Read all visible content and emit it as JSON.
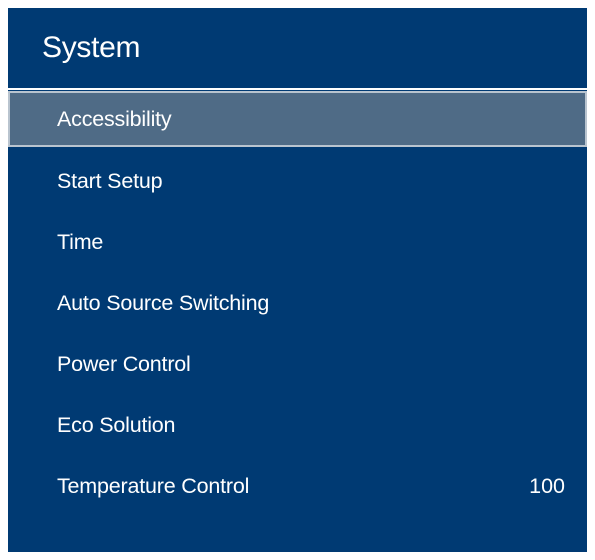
{
  "header": {
    "title": "System"
  },
  "menu": {
    "items": [
      {
        "label": "Accessibility",
        "value": "",
        "selected": true
      },
      {
        "label": "Start Setup",
        "value": ""
      },
      {
        "label": "Time",
        "value": ""
      },
      {
        "label": "Auto Source Switching",
        "value": ""
      },
      {
        "label": "Power Control",
        "value": ""
      },
      {
        "label": "Eco Solution",
        "value": ""
      },
      {
        "label": "Temperature Control",
        "value": "100"
      }
    ]
  },
  "colors": {
    "background": "#003a73",
    "selected_background": "#4f6b86",
    "selected_border": "#b9c4cf",
    "text": "#ffffff"
  }
}
